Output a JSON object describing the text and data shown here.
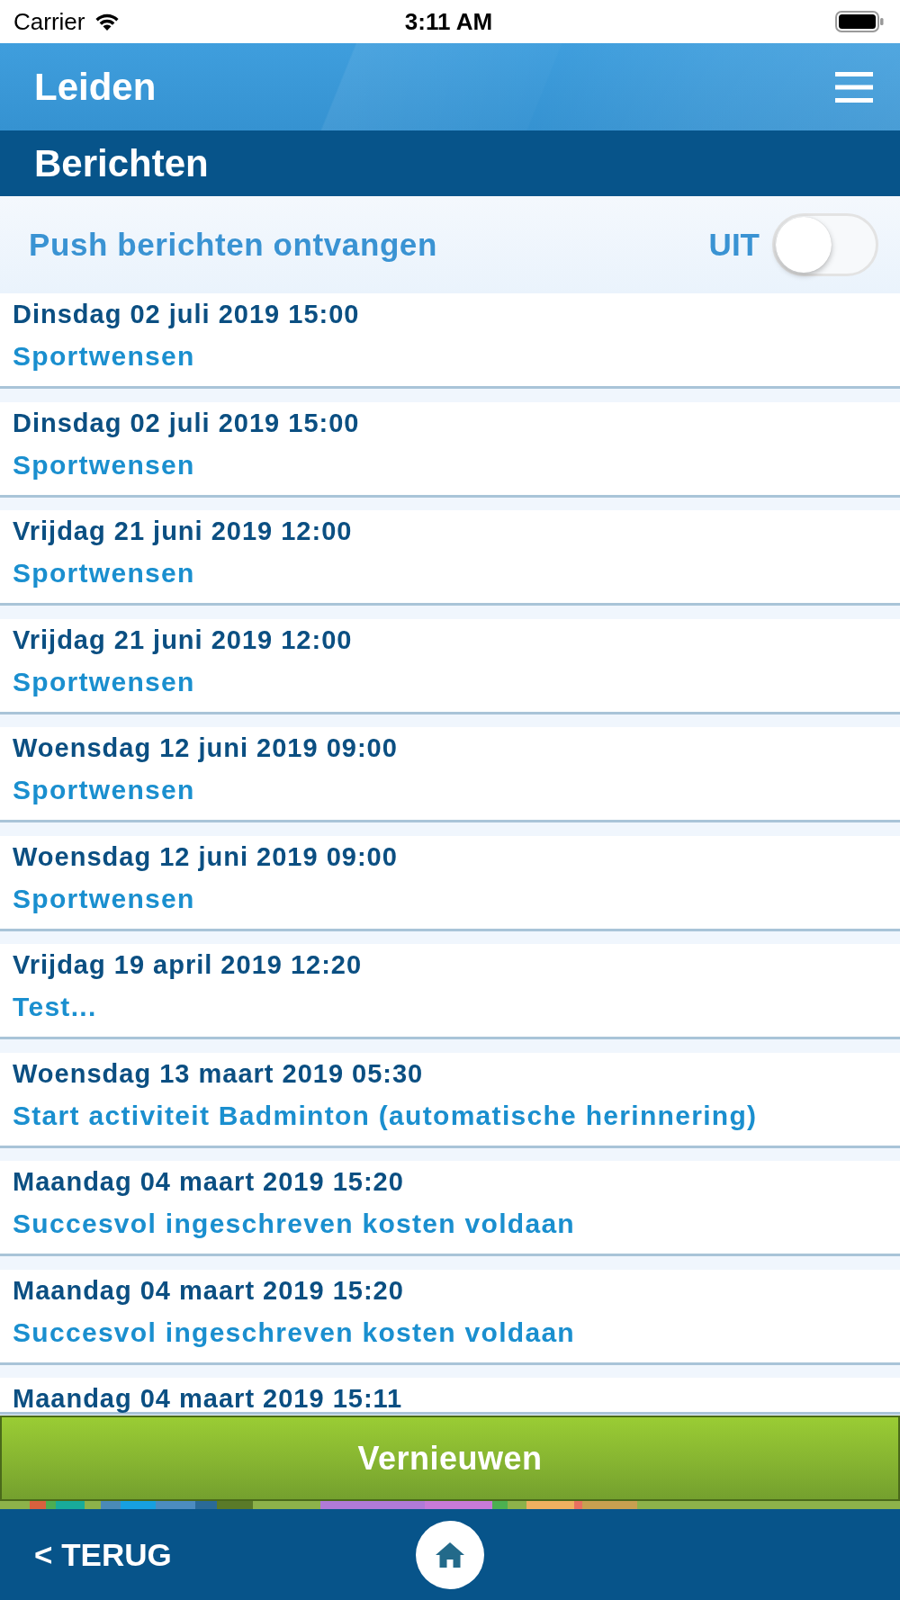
{
  "status_bar": {
    "carrier": "Carrier",
    "time": "3:11 AM"
  },
  "header": {
    "title": "Leiden"
  },
  "section": {
    "title": "Berichten"
  },
  "push_setting": {
    "label": "Push berichten ontvangen",
    "state_label": "UIT",
    "on": false
  },
  "messages": [
    {
      "date": "Dinsdag 02 juli 2019 15:00",
      "title": "Sportwensen"
    },
    {
      "date": "Dinsdag 02 juli 2019 15:00",
      "title": "Sportwensen"
    },
    {
      "date": "Vrijdag 21 juni 2019 12:00",
      "title": "Sportwensen"
    },
    {
      "date": "Vrijdag 21 juni 2019 12:00",
      "title": "Sportwensen"
    },
    {
      "date": "Woensdag 12 juni 2019 09:00",
      "title": "Sportwensen"
    },
    {
      "date": "Woensdag 12 juni 2019 09:00",
      "title": "Sportwensen"
    },
    {
      "date": "Vrijdag 19 april 2019 12:20",
      "title": "Test..."
    },
    {
      "date": "Woensdag 13 maart 2019 05:30",
      "title": "Start activiteit Badminton (automatische herinnering)"
    },
    {
      "date": "Maandag 04 maart 2019 15:20",
      "title": "Succesvol ingeschreven kosten voldaan"
    },
    {
      "date": "Maandag 04 maart 2019 15:20",
      "title": "Succesvol ingeschreven kosten voldaan"
    },
    {
      "date": "Maandag 04 maart 2019 15:11"
    }
  ],
  "refresh_button": {
    "label": "Vernieuwen"
  },
  "bottom_nav": {
    "back_label": "< TERUG"
  }
}
